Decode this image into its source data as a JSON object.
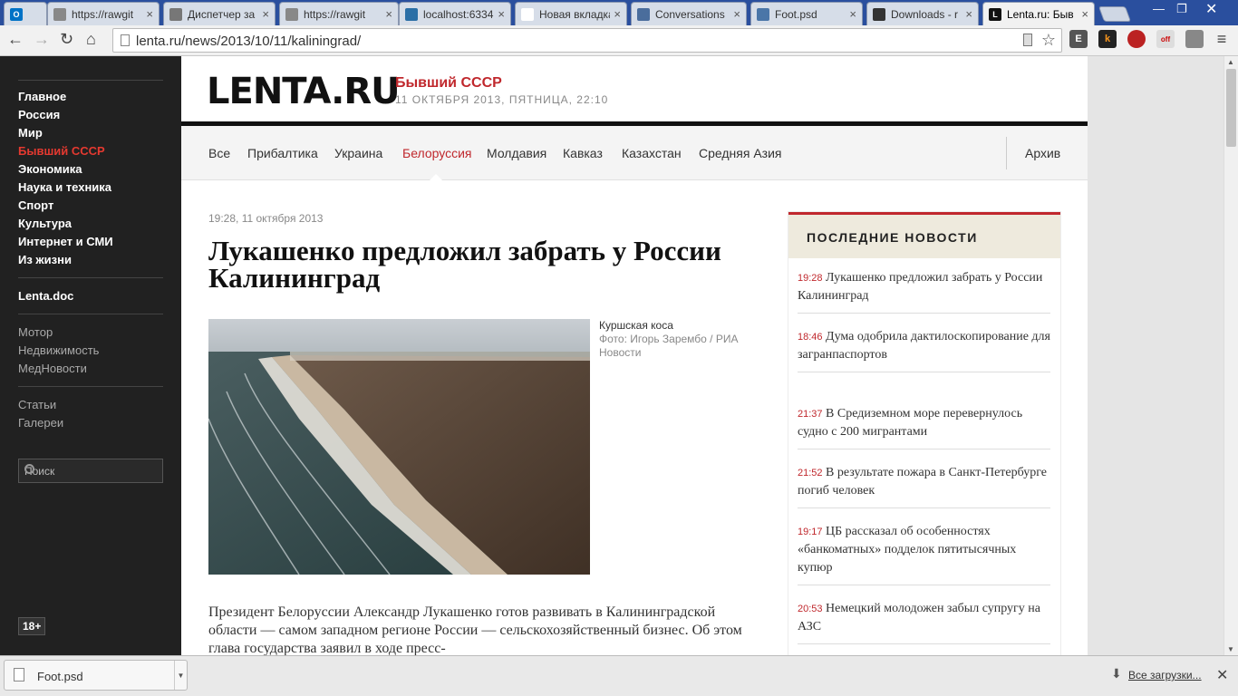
{
  "browser": {
    "tabs": [
      {
        "title": "",
        "icon": "outlook-icon",
        "color": "#0072c6"
      },
      {
        "title": "https://rawgit",
        "icon": "page-icon",
        "color": "#888888"
      },
      {
        "title": "Диспетчер за",
        "icon": "star-icon",
        "color": "#777777"
      },
      {
        "title": "https://rawgit",
        "icon": "page-icon",
        "color": "#888888"
      },
      {
        "title": "localhost:6334",
        "icon": "wordpress-icon",
        "color": "#2b6fa6"
      },
      {
        "title": "Новая вкладка",
        "icon": "none",
        "color": "#ffffff"
      },
      {
        "title": "Conversations",
        "icon": "chat-icon",
        "color": "#4a6d9c"
      },
      {
        "title": "Foot.psd",
        "icon": "vk-icon",
        "color": "#4a76a8"
      },
      {
        "title": "Downloads - r",
        "icon": "github-icon",
        "color": "#333333"
      },
      {
        "title": "Lenta.ru: Быв",
        "icon": "lenta-icon",
        "color": "#111111"
      }
    ],
    "url": "lenta.ru/news/2013/10/11/kaliningrad/"
  },
  "sidebar": {
    "primary": [
      "Главное",
      "Россия",
      "Мир",
      "Бывший СССР",
      "Экономика",
      "Наука и техника",
      "Спорт",
      "Культура",
      "Интернет и СМИ",
      "Из жизни"
    ],
    "doc": "Lenta.doc",
    "secondary": [
      "Мотор",
      "Недвижимость",
      "МедНовости"
    ],
    "tertiary": [
      "Статьи",
      "Галереи"
    ],
    "search_placeholder": "Поиск",
    "age_badge": "18+"
  },
  "header": {
    "logo": "LENTA.RU",
    "section": "Бывший СССР",
    "date": "11 ОКТЯБРЯ 2013, ПЯТНИЦА, 22:10"
  },
  "subnav": {
    "items": [
      "Все",
      "Прибалтика",
      "Украина",
      "Белоруссия",
      "Молдавия",
      "Кавказ",
      "Казахстан",
      "Средняя Азия"
    ],
    "active": "Белоруссия",
    "archive": "Архив"
  },
  "article": {
    "timestamp": "19:28, 11 октября 2013",
    "title": "Лукашенко предложил забрать у России Калининград",
    "caption": "Куршская коса",
    "credit": "Фото: Игорь Зарембо / РИА Новости",
    "lead": "Президент Белоруссии Александр Лукашенко готов развивать в Калининградской области — самом западном регионе России — сельскохозяйственный бизнес. Об этом глава государства заявил в ходе пресс-"
  },
  "latest": {
    "title": "ПОСЛЕДНИЕ НОВОСТИ",
    "items": [
      {
        "time": "19:28",
        "text": "Лукашенко предложил забрать у России Калининград"
      },
      {
        "time": "18:46",
        "text": "Дума одобрила дактилоскопирование для загранпаспортов"
      },
      {
        "time": "21:37",
        "text": "В Средиземном море перевернулось судно с 200 мигрантами"
      },
      {
        "time": "21:52",
        "text": "В результате пожара в Санкт-Петербурге погиб человек"
      },
      {
        "time": "19:17",
        "text": "ЦБ рассказал об особенностях «банкоматных» подделок пятитысячных купюр"
      },
      {
        "time": "20:53",
        "text": "Немецкий молодожен забыл супругу на АЗС"
      }
    ]
  },
  "downloads": {
    "file": "Foot.psd",
    "all_label": "Все загрузки..."
  },
  "colors": {
    "accent": "#c0282d",
    "sidebar_bg": "#212121",
    "tabbar": "#2a4f9e"
  }
}
